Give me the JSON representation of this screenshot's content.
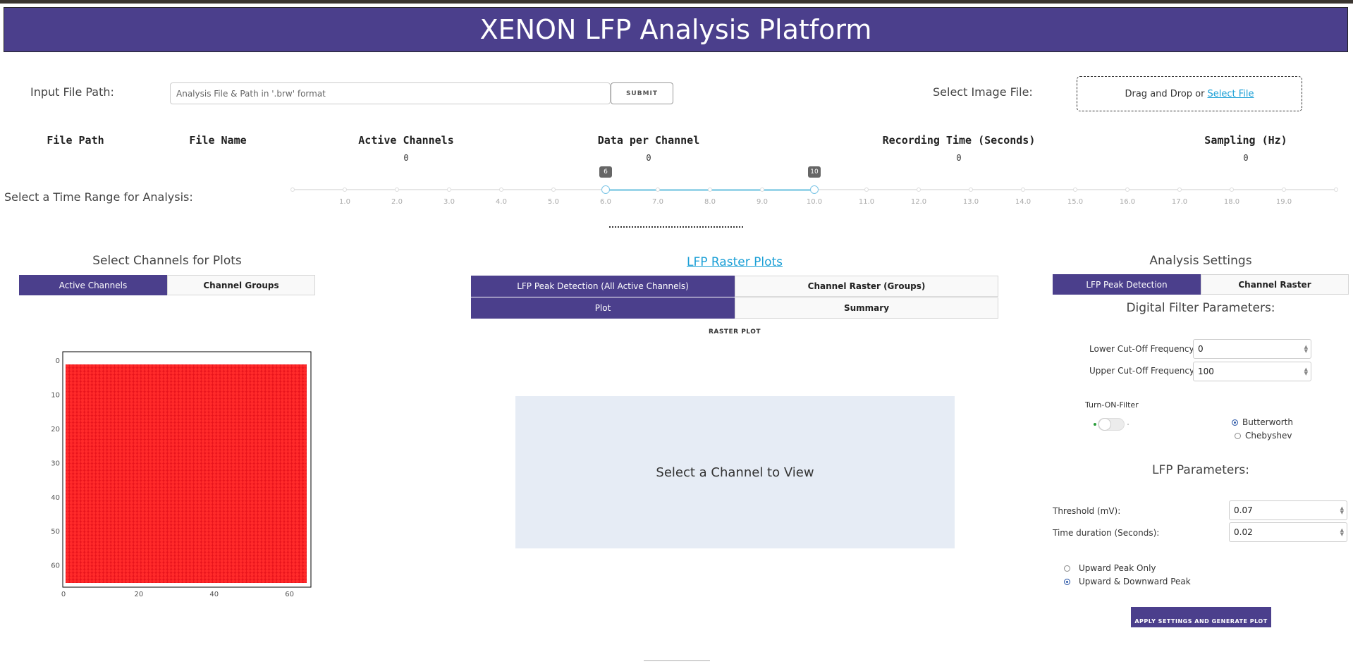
{
  "app": {
    "title": "XENON LFP Analysis Platform"
  },
  "file_input": {
    "label": "Input File Path:",
    "placeholder": "Analysis File & Path in '.brw' format",
    "submit_label": "SUBMIT"
  },
  "image_input": {
    "label": "Select Image File:",
    "drop_text": "Drag and Drop or",
    "select_link": "Select File"
  },
  "stats": {
    "file_path": {
      "label": "File Path"
    },
    "file_name": {
      "label": "File Name"
    },
    "active_channels": {
      "label": "Active Channels",
      "value": "0"
    },
    "data_per_channel": {
      "label": "Data per Channel",
      "value": "0"
    },
    "recording_time": {
      "label": "Recording Time (Seconds)",
      "value": "0"
    },
    "sampling": {
      "label": "Sampling (Hz)",
      "value": "0"
    }
  },
  "time_range": {
    "label": "Select a Time Range for Analysis:",
    "ticks": [
      "1.0",
      "2.0",
      "3.0",
      "4.0",
      "5.0",
      "6.0",
      "7.0",
      "8.0",
      "9.0",
      "10.0",
      "11.0",
      "12.0",
      "13.0",
      "14.0",
      "15.0",
      "16.0",
      "17.0",
      "18.0",
      "19.0"
    ],
    "min": 0,
    "max": 20,
    "low": 6,
    "high": 10,
    "low_label": "6",
    "high_label": "10"
  },
  "channels_panel": {
    "title": "Select Channels for Plots",
    "tabs": [
      "Active Channels",
      "Channel Groups"
    ],
    "grid_rows": 64,
    "grid_cols": 64,
    "grid_color": "#e8141c",
    "y_ticks": [
      "0",
      "10",
      "20",
      "30",
      "40",
      "50",
      "60"
    ],
    "x_ticks": [
      "0",
      "20",
      "40",
      "60"
    ]
  },
  "raster_panel": {
    "title": "LFP Raster Plots",
    "tabs_row1": [
      "LFP Peak Detection (All Active Channels)",
      "Channel Raster (Groups)"
    ],
    "tabs_row2": [
      "Plot",
      "Summary"
    ],
    "plot_title": "RASTER PLOT",
    "placeholder": "Select a Channel to View"
  },
  "settings": {
    "title": "Analysis Settings",
    "tabs": [
      "LFP Peak Detection",
      "Channel Raster"
    ],
    "filter_title": "Digital Filter Parameters:",
    "lower_label": "Lower Cut-Off Frequency:",
    "lower_value": "0",
    "upper_label": "Upper Cut-Off Frequency:",
    "upper_value": "100",
    "toggle_label": "Turn-ON-Filter",
    "filter_types": [
      "Butterworth",
      "Chebyshev"
    ],
    "lfp_title": "LFP Parameters:",
    "threshold_label": "Threshold (mV):",
    "threshold_value": "0.07",
    "duration_label": "Time duration (Seconds):",
    "duration_value": "0.02",
    "peak_options": [
      "Upward Peak Only",
      "Upward & Downward Peak"
    ],
    "apply_label": "APPLY SETTINGS AND GENERATE PLOT"
  },
  "colors": {
    "accent": "#4b3f8c",
    "link": "#1a9fd6",
    "slider": "#9bd5e9",
    "grid": "#e8141c"
  }
}
